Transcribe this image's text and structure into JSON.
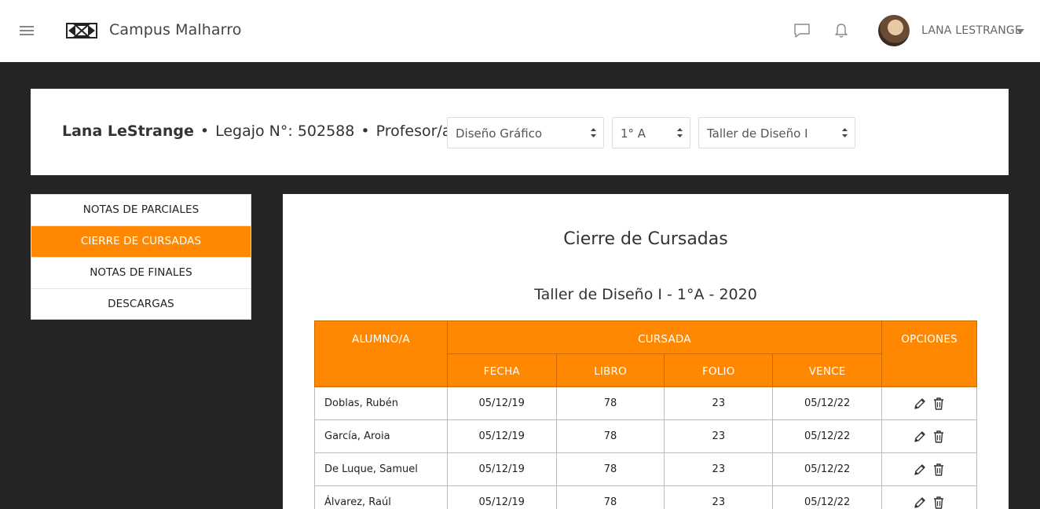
{
  "header": {
    "brand": "Campus Malharro",
    "user_name": "LANA LESTRANGE"
  },
  "info": {
    "name": "Lana LeStrange",
    "legajo": "Legajo N°: 502588",
    "role": "Profesor/a de",
    "select_career": "Diseño Gráfico",
    "select_course": "1° A",
    "select_subject": "Taller de Diseño I"
  },
  "sidebar": {
    "items": [
      {
        "label": "NOTAS DE PARCIALES"
      },
      {
        "label": "CIERRE DE CURSADAS"
      },
      {
        "label": "NOTAS DE FINALES"
      },
      {
        "label": "DESCARGAS"
      }
    ]
  },
  "main": {
    "title": "Cierre de Cursadas",
    "subtitle": "Taller de Diseño I - 1°A - 2020",
    "table": {
      "headers": {
        "student": "ALUMNO/A",
        "cursada": "CURSADA",
        "options": "OPCIONES",
        "fecha": "FECHA",
        "libro": "LIBRO",
        "folio": "FOLIO",
        "vence": "VENCE"
      },
      "rows": [
        {
          "name": "Doblas, Rubén",
          "fecha": "05/12/19",
          "libro": "78",
          "folio": "23",
          "vence": "05/12/22"
        },
        {
          "name": "García, Aroia",
          "fecha": "05/12/19",
          "libro": "78",
          "folio": "23",
          "vence": "05/12/22"
        },
        {
          "name": "De Luque, Samuel",
          "fecha": "05/12/19",
          "libro": "78",
          "folio": "23",
          "vence": "05/12/22"
        },
        {
          "name": "Álvarez, Raúl",
          "fecha": "05/12/19",
          "libro": "78",
          "folio": "23",
          "vence": "05/12/22"
        }
      ]
    }
  },
  "colors": {
    "accent": "#ff8800",
    "background": "#242424"
  }
}
